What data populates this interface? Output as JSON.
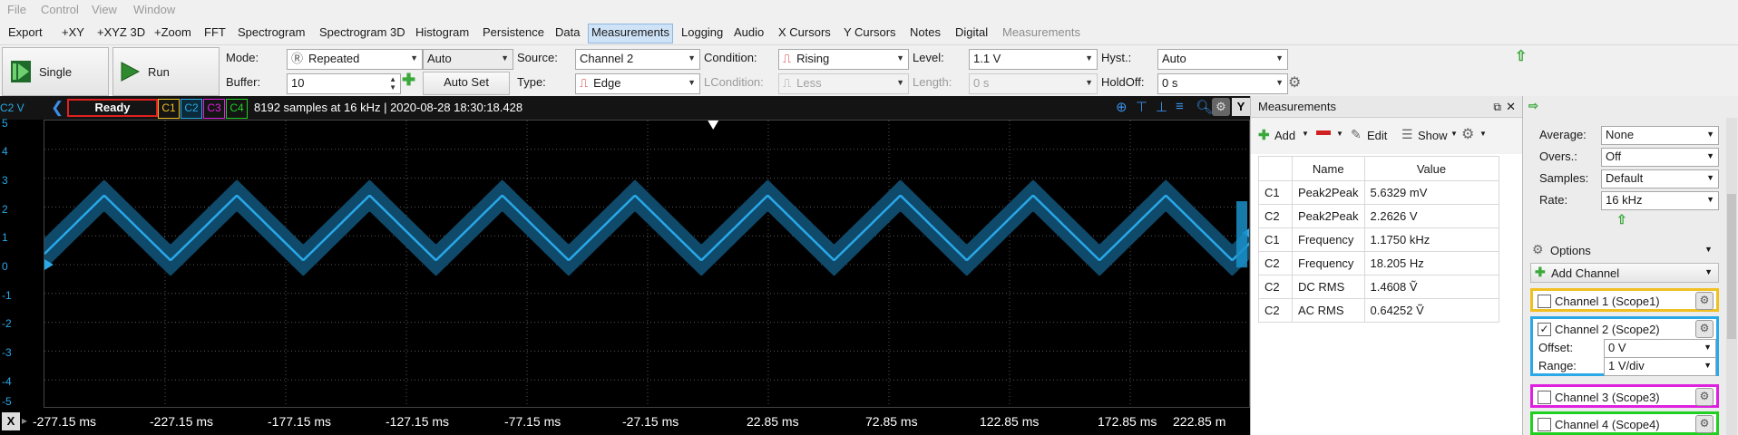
{
  "menu": [
    "File",
    "Control",
    "View",
    "Window"
  ],
  "tabs": [
    "Export",
    "+XY",
    "+XYZ 3D",
    "+Zoom",
    "FFT",
    "Spectrogram",
    "Spectrogram 3D",
    "Histogram",
    "Persistence",
    "Data",
    "Measurements",
    "Logging",
    "Audio",
    "X Cursors",
    "Y Cursors",
    "Notes",
    "Digital",
    "Measurements"
  ],
  "controls": {
    "single_label": "Single",
    "run_label": "Run",
    "mode_label": "Mode:",
    "mode_value": "Repeated",
    "auto_value": "Auto",
    "buffer_label": "Buffer:",
    "buffer_value": "10",
    "auto_set_label": "Auto Set",
    "source_label": "Source:",
    "source_value": "Channel 2",
    "type_label": "Type:",
    "type_value": "Edge",
    "condition_label": "Condition:",
    "condition_value": "Rising",
    "lcondition_label": "LCondition:",
    "lcondition_value": "Less",
    "level_label": "Level:",
    "level_value": "1.1 V",
    "length_label": "Length:",
    "length_value": "0 s",
    "hyst_label": "Hyst.:",
    "hyst_value": "Auto",
    "holdoff_label": "HoldOff:",
    "holdoff_value": "0 s"
  },
  "status": {
    "channel_unit": "C2 V",
    "state": "Ready",
    "ch": [
      "C1",
      "C2",
      "C3",
      "C4"
    ],
    "info": "8192 samples at 16 kHz | 2020-08-28 18:30:18.428",
    "y_button": "Y"
  },
  "plot": {
    "y_ticks": [
      "5",
      "4",
      "3",
      "2",
      "1",
      "0",
      "-1",
      "-2",
      "-3",
      "-4",
      "-5"
    ],
    "x_ticks": [
      "-277.15 ms",
      "-227.15 ms",
      "-177.15 ms",
      "-127.15 ms",
      "-77.15 ms",
      "-27.15 ms",
      "22.85 ms",
      "72.85 ms",
      "122.85 ms",
      "172.85 ms",
      "222.85 m"
    ],
    "x_button": "X",
    "wave": {
      "min_v": 0.15,
      "max_v": 2.4,
      "period_ms": 55,
      "band_half_v": 0.55,
      "x_start_ms": -277.15,
      "x_end_ms": 222.85,
      "y_min": -5,
      "y_max": 5
    },
    "trace_color": "#2aa8e8",
    "band_color": "#0f4a6b"
  },
  "measurements": {
    "title": "Measurements",
    "add": "Add",
    "edit": "Edit",
    "show": "Show",
    "col_name": "Name",
    "col_value": "Value",
    "rows": [
      {
        "ch": "C1",
        "name": "Peak2Peak",
        "value": "5.6329 mV"
      },
      {
        "ch": "C2",
        "name": "Peak2Peak",
        "value": "2.2626 V"
      },
      {
        "ch": "C1",
        "name": "Frequency",
        "value": "1.1750 kHz"
      },
      {
        "ch": "C2",
        "name": "Frequency",
        "value": "18.205 Hz"
      },
      {
        "ch": "C2",
        "name": "DC RMS",
        "value": "1.4608 Ṽ"
      },
      {
        "ch": "C2",
        "name": "AC RMS",
        "value": "0.64252 Ṽ"
      }
    ]
  },
  "right": {
    "average_label": "Average:",
    "average_value": "None",
    "overs_label": "Overs.:",
    "overs_value": "Off",
    "samples_label": "Samples:",
    "samples_value": "Default",
    "rate_label": "Rate:",
    "rate_value": "16 kHz",
    "options_label": "Options",
    "add_channel": "Add Channel",
    "ch1": "Channel 1 (Scope1)",
    "ch2": "Channel 2 (Scope2)",
    "offset_label": "Offset:",
    "offset_value": "0 V",
    "range_label": "Range:",
    "range_value": "1 V/div",
    "ch3": "Channel 3 (Scope3)",
    "ch4": "Channel 4 (Scope4)"
  },
  "colors": {
    "c1": "#f0c020",
    "c2": "#2aa8e8",
    "c3": "#e020e0",
    "c4": "#20d020",
    "ready_border": "#e02020"
  }
}
